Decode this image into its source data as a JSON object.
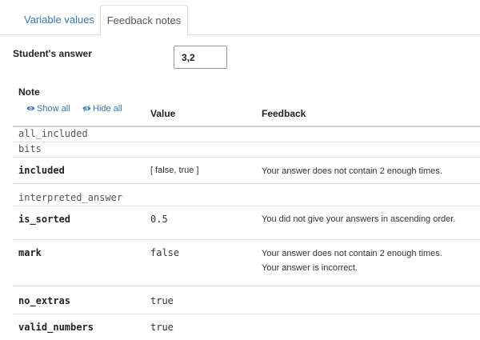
{
  "tabs": [
    {
      "label": "Variable values",
      "active": false
    },
    {
      "label": "Feedback notes",
      "active": true
    }
  ],
  "answer": {
    "label": "Student's answer",
    "value": "3,2"
  },
  "table": {
    "note_header": "Note",
    "show_all": "Show all",
    "hide_all": "Hide all",
    "value_header": "Value",
    "feedback_header": "Feedback",
    "rows": [
      {
        "note": "all_included",
        "value": "",
        "feedback": []
      },
      {
        "note": "bits",
        "value": "",
        "feedback": []
      },
      {
        "note": "included",
        "value": "[ false, true ]",
        "feedback": [
          "Your answer does not contain 2 enough times."
        ]
      },
      {
        "note": "interpreted_answer",
        "value": "",
        "feedback": []
      },
      {
        "note": "is_sorted",
        "value": "0.5",
        "feedback": [
          "You did not give your answers in ascending order."
        ]
      },
      {
        "note": "mark",
        "value": "false",
        "feedback": [
          "Your answer does not contain 2 enough times.",
          "Your answer is incorrect."
        ]
      },
      {
        "note": "no_extras",
        "value": "true",
        "feedback": []
      },
      {
        "note": "valid_numbers",
        "value": "true",
        "feedback": []
      }
    ]
  },
  "colors": {
    "link": "#337ab7",
    "border": "#dddddd"
  },
  "icons": {
    "show_all": "eye-icon",
    "hide_all": "eye-slash-icon"
  }
}
